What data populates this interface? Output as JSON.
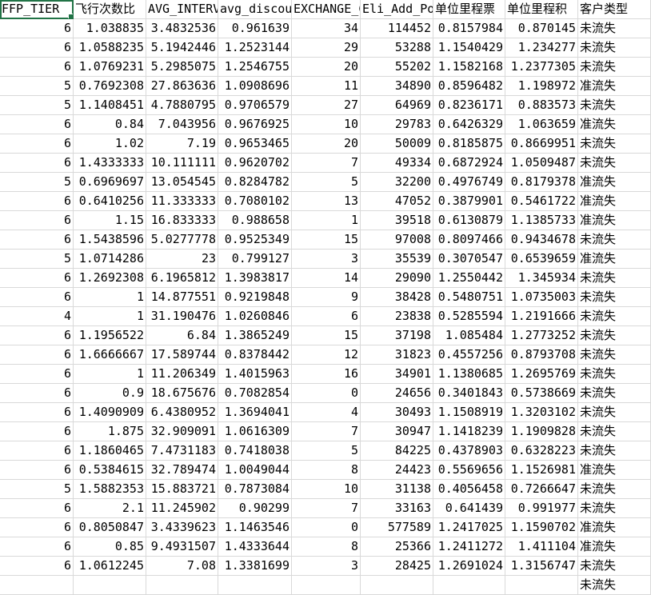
{
  "headers": [
    "FFP_TIER",
    "飞行次数比",
    "AVG_INTERV",
    "avg_discou",
    "EXCHANGE_C",
    "Eli_Add_Po",
    "单位里程票",
    "单位里程积",
    "客户类型"
  ],
  "rows": [
    [
      "6",
      "1.038835",
      "3.4832536",
      "0.961639",
      "34",
      "114452",
      "0.8157984",
      "0.870145",
      "未流失"
    ],
    [
      "6",
      "1.0588235",
      "5.1942446",
      "1.2523144",
      "29",
      "53288",
      "1.1540429",
      "1.234277",
      "未流失"
    ],
    [
      "6",
      "1.0769231",
      "5.2985075",
      "1.2546755",
      "20",
      "55202",
      "1.1582168",
      "1.2377305",
      "未流失"
    ],
    [
      "5",
      "0.7692308",
      "27.863636",
      "1.0908696",
      "11",
      "34890",
      "0.8596482",
      "1.198972",
      "准流失"
    ],
    [
      "5",
      "1.1408451",
      "4.7880795",
      "0.9706579",
      "27",
      "64969",
      "0.8236171",
      "0.883573",
      "未流失"
    ],
    [
      "6",
      "0.84",
      "7.043956",
      "0.9676925",
      "10",
      "29783",
      "0.6426329",
      "1.063659",
      "准流失"
    ],
    [
      "6",
      "1.02",
      "7.19",
      "0.9653465",
      "20",
      "50009",
      "0.8185875",
      "0.8669951",
      "未流失"
    ],
    [
      "6",
      "1.4333333",
      "10.111111",
      "0.9620702",
      "7",
      "49334",
      "0.6872924",
      "1.0509487",
      "未流失"
    ],
    [
      "5",
      "0.6969697",
      "13.054545",
      "0.8284782",
      "5",
      "32200",
      "0.4976749",
      "0.8179378",
      "准流失"
    ],
    [
      "6",
      "0.6410256",
      "11.333333",
      "0.7080102",
      "13",
      "47052",
      "0.3879901",
      "0.5461722",
      "准流失"
    ],
    [
      "6",
      "1.15",
      "16.833333",
      "0.988658",
      "1",
      "39518",
      "0.6130879",
      "1.1385733",
      "准流失"
    ],
    [
      "6",
      "1.5438596",
      "5.0277778",
      "0.9525349",
      "15",
      "97008",
      "0.8097466",
      "0.9434678",
      "未流失"
    ],
    [
      "5",
      "1.0714286",
      "23",
      "0.799127",
      "3",
      "35539",
      "0.3070547",
      "0.6539659",
      "准流失"
    ],
    [
      "6",
      "1.2692308",
      "6.1965812",
      "1.3983817",
      "14",
      "29090",
      "1.2550442",
      "1.345934",
      "未流失"
    ],
    [
      "6",
      "1",
      "14.877551",
      "0.9219848",
      "9",
      "38428",
      "0.5480751",
      "1.0735003",
      "未流失"
    ],
    [
      "4",
      "1",
      "31.190476",
      "1.0260846",
      "6",
      "23838",
      "0.5285594",
      "1.2191666",
      "未流失"
    ],
    [
      "6",
      "1.1956522",
      "6.84",
      "1.3865249",
      "15",
      "37198",
      "1.085484",
      "1.2773252",
      "未流失"
    ],
    [
      "6",
      "1.6666667",
      "17.589744",
      "0.8378442",
      "12",
      "31823",
      "0.4557256",
      "0.8793708",
      "未流失"
    ],
    [
      "6",
      "1",
      "11.206349",
      "1.4015963",
      "16",
      "34901",
      "1.1380685",
      "1.2695769",
      "未流失"
    ],
    [
      "6",
      "0.9",
      "18.675676",
      "0.7082854",
      "0",
      "24656",
      "0.3401843",
      "0.5738669",
      "未流失"
    ],
    [
      "6",
      "1.4090909",
      "6.4380952",
      "1.3694041",
      "4",
      "30493",
      "1.1508919",
      "1.3203102",
      "未流失"
    ],
    [
      "6",
      "1.875",
      "32.909091",
      "1.0616309",
      "7",
      "30947",
      "1.1418239",
      "1.1909828",
      "未流失"
    ],
    [
      "6",
      "1.1860465",
      "7.4731183",
      "0.7418038",
      "5",
      "84225",
      "0.4378903",
      "0.6328223",
      "未流失"
    ],
    [
      "6",
      "0.5384615",
      "32.789474",
      "1.0049044",
      "8",
      "24423",
      "0.5569656",
      "1.1526981",
      "准流失"
    ],
    [
      "5",
      "1.5882353",
      "15.883721",
      "0.7873084",
      "10",
      "31138",
      "0.4056458",
      "0.7266647",
      "未流失"
    ],
    [
      "6",
      "2.1",
      "11.245902",
      "0.90299",
      "7",
      "33163",
      "0.641439",
      "0.991977",
      "未流失"
    ],
    [
      "6",
      "0.8050847",
      "3.4339623",
      "1.1463546",
      "0",
      "577589",
      "1.2417025",
      "1.1590702",
      "准流失"
    ],
    [
      "6",
      "0.85",
      "9.4931507",
      "1.4333644",
      "8",
      "25366",
      "1.2411272",
      "1.411104",
      "准流失"
    ],
    [
      "6",
      "1.0612245",
      "7.08",
      "1.3381699",
      "3",
      "28425",
      "1.2691024",
      "1.3156747",
      "未流失"
    ],
    [
      "",
      "",
      "",
      "",
      "",
      "",
      "",
      "",
      "未流失"
    ]
  ],
  "colors": {
    "gridline": "#d9d9d9",
    "selection": "#217346"
  }
}
